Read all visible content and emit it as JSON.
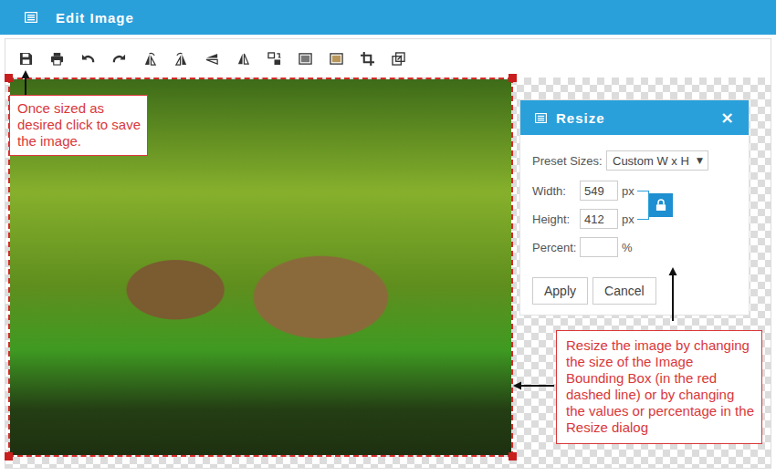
{
  "window": {
    "title": "Edit Image"
  },
  "resize_dialog": {
    "title": "Resize",
    "close": "×",
    "preset": {
      "label": "Preset Sizes:",
      "value": "Custom W x H",
      "arrow": "▼"
    },
    "fields": [
      {
        "label": "Width:",
        "value": "549",
        "unit": "px"
      },
      {
        "label": "Height:",
        "value": "412",
        "unit": "px"
      }
    ],
    "lock": {
      "locked": true
    },
    "percent": {
      "label": "Percent:",
      "value": "",
      "unit": "%"
    },
    "buttons": [
      "Apply",
      "Cancel"
    ]
  },
  "callouts": [
    {
      "text": "Once sized as desired click to save the image."
    },
    {
      "text": "Resize the image by changing the size of the Image Bounding Box (in the red dashed line) or by changing the values or percentage in the Resize dialog"
    }
  ]
}
